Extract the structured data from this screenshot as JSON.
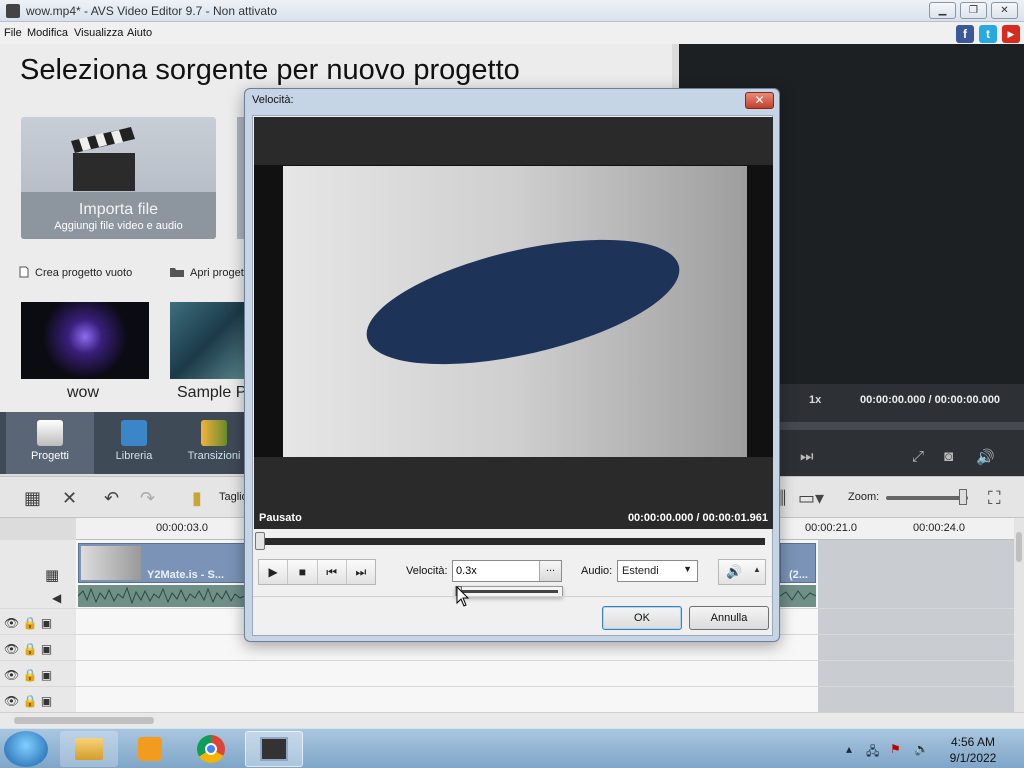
{
  "window": {
    "title": "wow.mp4* - AVS Video Editor 9.7 - Non attivato",
    "minimize": "▁",
    "maximize": "❐",
    "close": "✕"
  },
  "menu": {
    "file": "File",
    "edit": "Modifica",
    "view": "Visualizza",
    "help": "Aiuto"
  },
  "social": {
    "facebook": "f",
    "twitter": "t",
    "youtube": "▶"
  },
  "projects": {
    "heading": "Seleziona sorgente per nuovo progetto",
    "import_title": "Importa file",
    "import_subtitle": "Aggiungi file video e audio",
    "create_empty": "Crea progetto vuoto",
    "open_project": "Apri proget",
    "recent": [
      {
        "label": "wow"
      },
      {
        "label": "Sample P"
      }
    ]
  },
  "tabs": [
    {
      "label": "Progetti"
    },
    {
      "label": "Libreria"
    },
    {
      "label": "Transizioni"
    }
  ],
  "preview": {
    "speed": "1x",
    "time": "00:00:00.000 / 00:00:00.000"
  },
  "timeline": {
    "trim_label": "Taglio",
    "zoom_label": "Zoom:",
    "ruler": [
      "00:00:03.0",
      "00:00:21.0",
      "00:00:24.0"
    ],
    "clip_label": "Y2Mate.is - S...",
    "clip2_label": "(2..."
  },
  "dialog": {
    "title": "Velocità:",
    "status": "Pausato",
    "time": "00:00:00.000  /  00:00:01.961",
    "speed_label": "Velocità:",
    "speed_value": "0.3x",
    "speed_dots": "...",
    "audio_label": "Audio:",
    "audio_value": "Estendi",
    "ok": "OK",
    "cancel": "Annulla"
  },
  "taskbar": {
    "time": "4:56 AM",
    "date": "9/1/2022"
  },
  "colors": {
    "tabs_bg": "#3f4a57",
    "dialog_frame": "#c5d5e6",
    "clip": "#7a93b6"
  }
}
